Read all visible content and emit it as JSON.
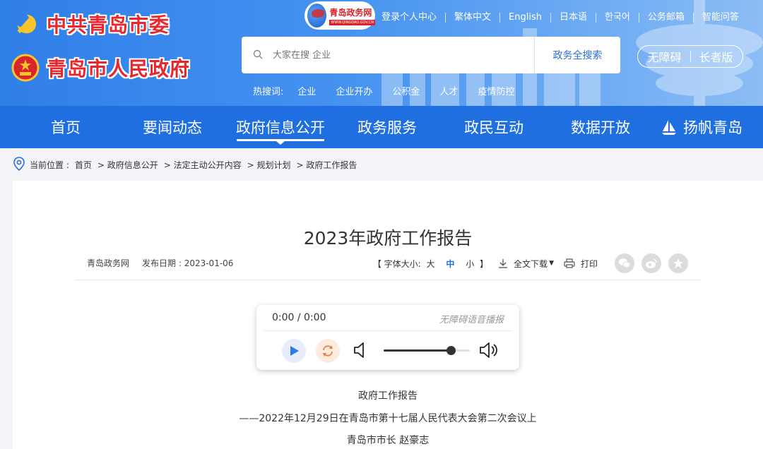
{
  "header": {
    "party_title": "中共青岛市委",
    "gov_title": "青岛市人民政府",
    "site_badge": {
      "name": "青岛政务网",
      "domain": "WWW.QINGDAO.GOV.CN"
    },
    "top_links": [
      "登录个人中心",
      "繁体中文",
      "English",
      "日本语",
      "한국어",
      "公务邮箱",
      "智能问答"
    ],
    "search": {
      "placeholder": "大家在搜 企业",
      "button": "政务全搜索"
    },
    "accessibility": {
      "barrier_free": "无障碍",
      "elder": "长者版"
    },
    "hot_search": {
      "label": "热搜词:",
      "keywords": [
        "企业",
        "企业开办",
        "公积金",
        "人才",
        "疫情防控"
      ]
    }
  },
  "nav": {
    "items": [
      "首页",
      "要闻动态",
      "政府信息公开",
      "政务服务",
      "政民互动",
      "数据开放",
      "扬帆青岛"
    ],
    "active_index": 2
  },
  "breadcrumb": {
    "label": "当前位置 :",
    "items": [
      "首页",
      "> 政府信息公开",
      "> 法定主动公开内容",
      "> 规划计划",
      "> 政府工作报告"
    ]
  },
  "article": {
    "title": "2023年政府工作报告",
    "source": "青岛政务网",
    "date_label": "发布日期 : 2023-01-06",
    "font_size": {
      "open": "【 字体大小:",
      "large": "大",
      "medium": "中",
      "small": "小",
      "close": "】"
    },
    "download": "全文下载",
    "print": "打印",
    "share_icons": [
      "wechat-icon",
      "weibo-icon",
      "favorite-star-icon"
    ],
    "body_lines": [
      "政府工作报告",
      "——2022年12月29日在青岛市第十七届人民代表大会第二次会议上",
      "青岛市市长  赵豪志"
    ]
  },
  "player": {
    "time": "0:00 / 0:00",
    "label": "无障碍语音播报",
    "volume": 0.78
  },
  "colors": {
    "nav_blue": "#1f6fe0",
    "brand_red": "#e8262b",
    "accent_blue": "#2c6fd6"
  }
}
